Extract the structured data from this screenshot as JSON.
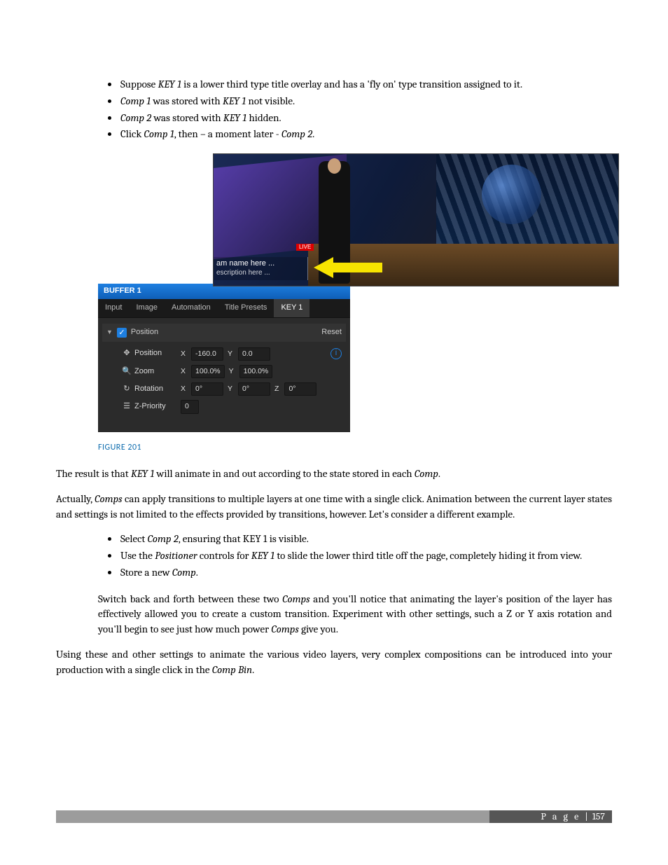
{
  "bullets_top": [
    {
      "pre": "Suppose ",
      "em": "KEY 1",
      "post": " is a lower third type title overlay and has a 'fly on' type transition assigned to it."
    },
    {
      "pre": "",
      "em": "Comp 1",
      "post": " was stored with ",
      "em2": "KEY 1",
      "post2": " not visible."
    },
    {
      "pre": "",
      "em": "Comp 2",
      "post": " was stored with ",
      "em2": "KEY 1",
      "post2": " hidden."
    },
    {
      "pre": "Click ",
      "em": "Comp 1",
      "post": ", then – a moment later - ",
      "em2": "Comp 2",
      "post2": "."
    }
  ],
  "figure_caption": "FIGURE 201",
  "shot": {
    "live": "LIVE",
    "lt_line1": "am name here ...",
    "lt_line2": "escription here ..."
  },
  "panel": {
    "title": "BUFFER 1",
    "tabs": [
      "Input",
      "Image",
      "Automation",
      "Title Presets",
      "KEY 1"
    ],
    "active_tab": 4,
    "section_label": "Position",
    "reset_label": "Reset",
    "rows": {
      "position": {
        "label": "Position",
        "x": "-160.0",
        "y": "0.0"
      },
      "zoom": {
        "label": "Zoom",
        "x": "100.0%",
        "y": "100.0%"
      },
      "rotation": {
        "label": "Rotation",
        "x": "0°",
        "y": "0°",
        "z": "0°"
      },
      "zpriority": {
        "label": "Z-Priority",
        "v": "0"
      }
    }
  },
  "para1": {
    "a": "The result is that ",
    "b": "KEY 1",
    "c": " will animate in and out according to the state stored in each ",
    "d": "Comp",
    "e": "."
  },
  "para2": {
    "a": "Actually, ",
    "b": "Comps",
    "c": " can apply transitions to multiple layers at one time with a single click.  Animation between the current layer states and settings is not limited to the effects provided by transitions, however.  Let's consider a different example."
  },
  "bullets_mid": [
    {
      "a": "Select ",
      "b": "Comp 2",
      "c": ", ensuring that KEY 1 is visible."
    },
    {
      "a": "Use the ",
      "b": "Positioner",
      "c": " controls for ",
      "d": "KEY 1",
      "e": " to slide the lower third title off the page, completely hiding it from view."
    },
    {
      "a": "Store a new ",
      "b": "Comp",
      "c": "."
    }
  ],
  "para3": {
    "a": "Switch back and forth between these two ",
    "b": "Comps",
    "c": " and you'll notice that animating the layer's position of the layer has effectively allowed you to create a custom transition.  Experiment with other settings, such a Z or Y axis rotation and you'll begin to see just how much power ",
    "d": "Comps",
    "e": " give you."
  },
  "para4": {
    "a": "Using these and other settings to animate the various video layers, very complex compositions can be introduced into your production with a single click in the ",
    "b": "Comp Bin",
    "c": "."
  },
  "footer": {
    "label": "P a g e",
    "sep": " | ",
    "num": "157"
  }
}
